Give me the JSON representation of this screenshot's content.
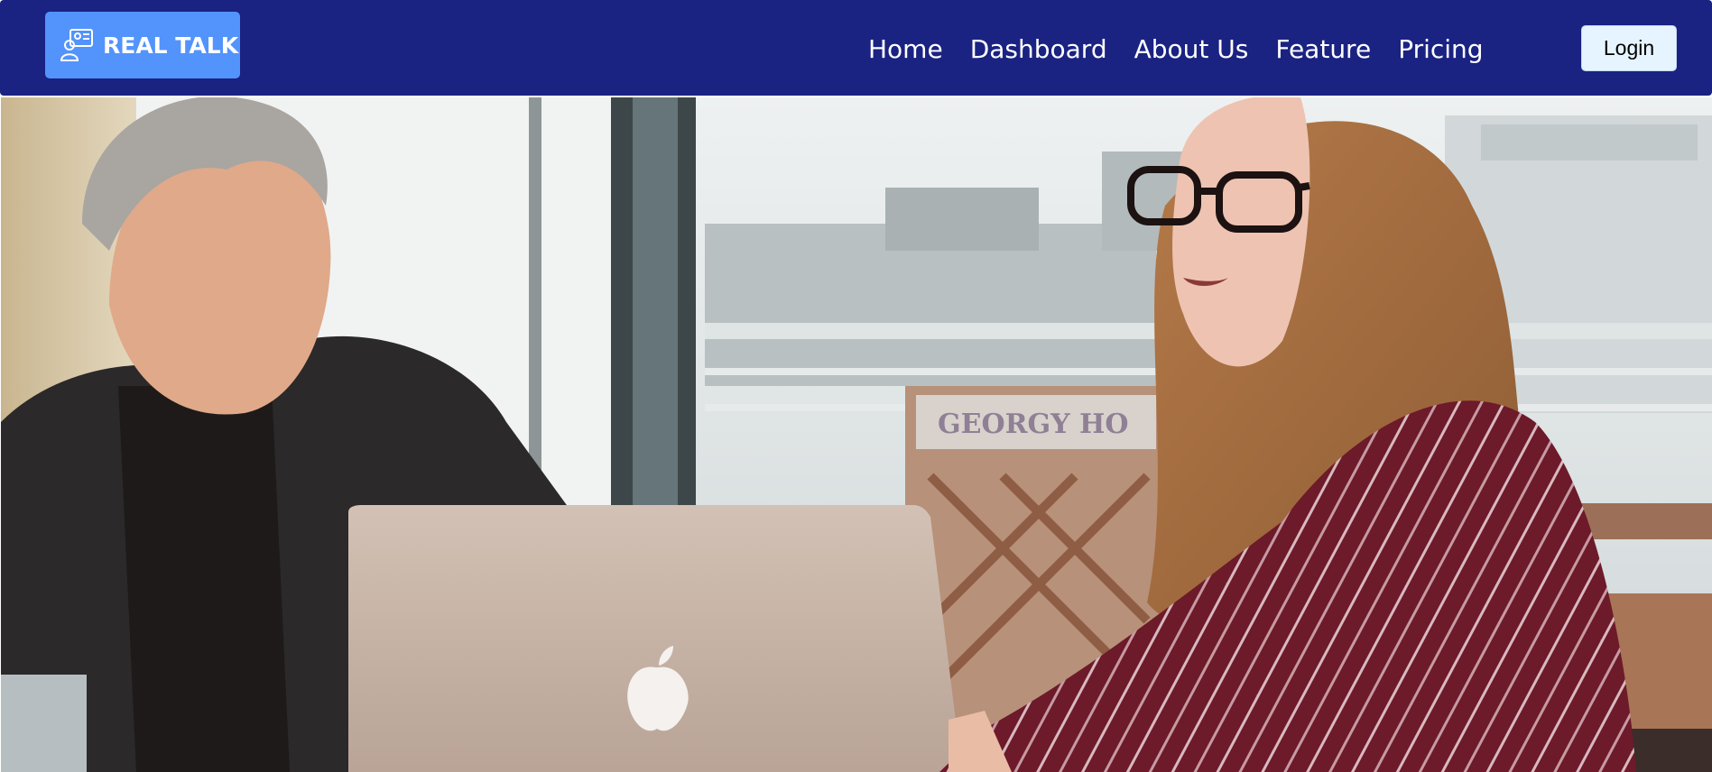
{
  "brand": {
    "name": "REAL TALK",
    "icon": "people-chat-icon"
  },
  "nav": {
    "items": [
      {
        "label": "Home"
      },
      {
        "label": "Dashboard"
      },
      {
        "label": "About Us"
      },
      {
        "label": "Feature"
      },
      {
        "label": "Pricing"
      }
    ],
    "login_label": "Login"
  },
  "hero": {
    "image": "photo of a man and a woman looking at a laptop in a cafe",
    "sign_text": "GEORGY HO"
  },
  "colors": {
    "navbar": "#1a2282",
    "logo_bg": "#5393fc",
    "login_bg": "#e6f4ff",
    "nav_text": "#ffffff"
  }
}
